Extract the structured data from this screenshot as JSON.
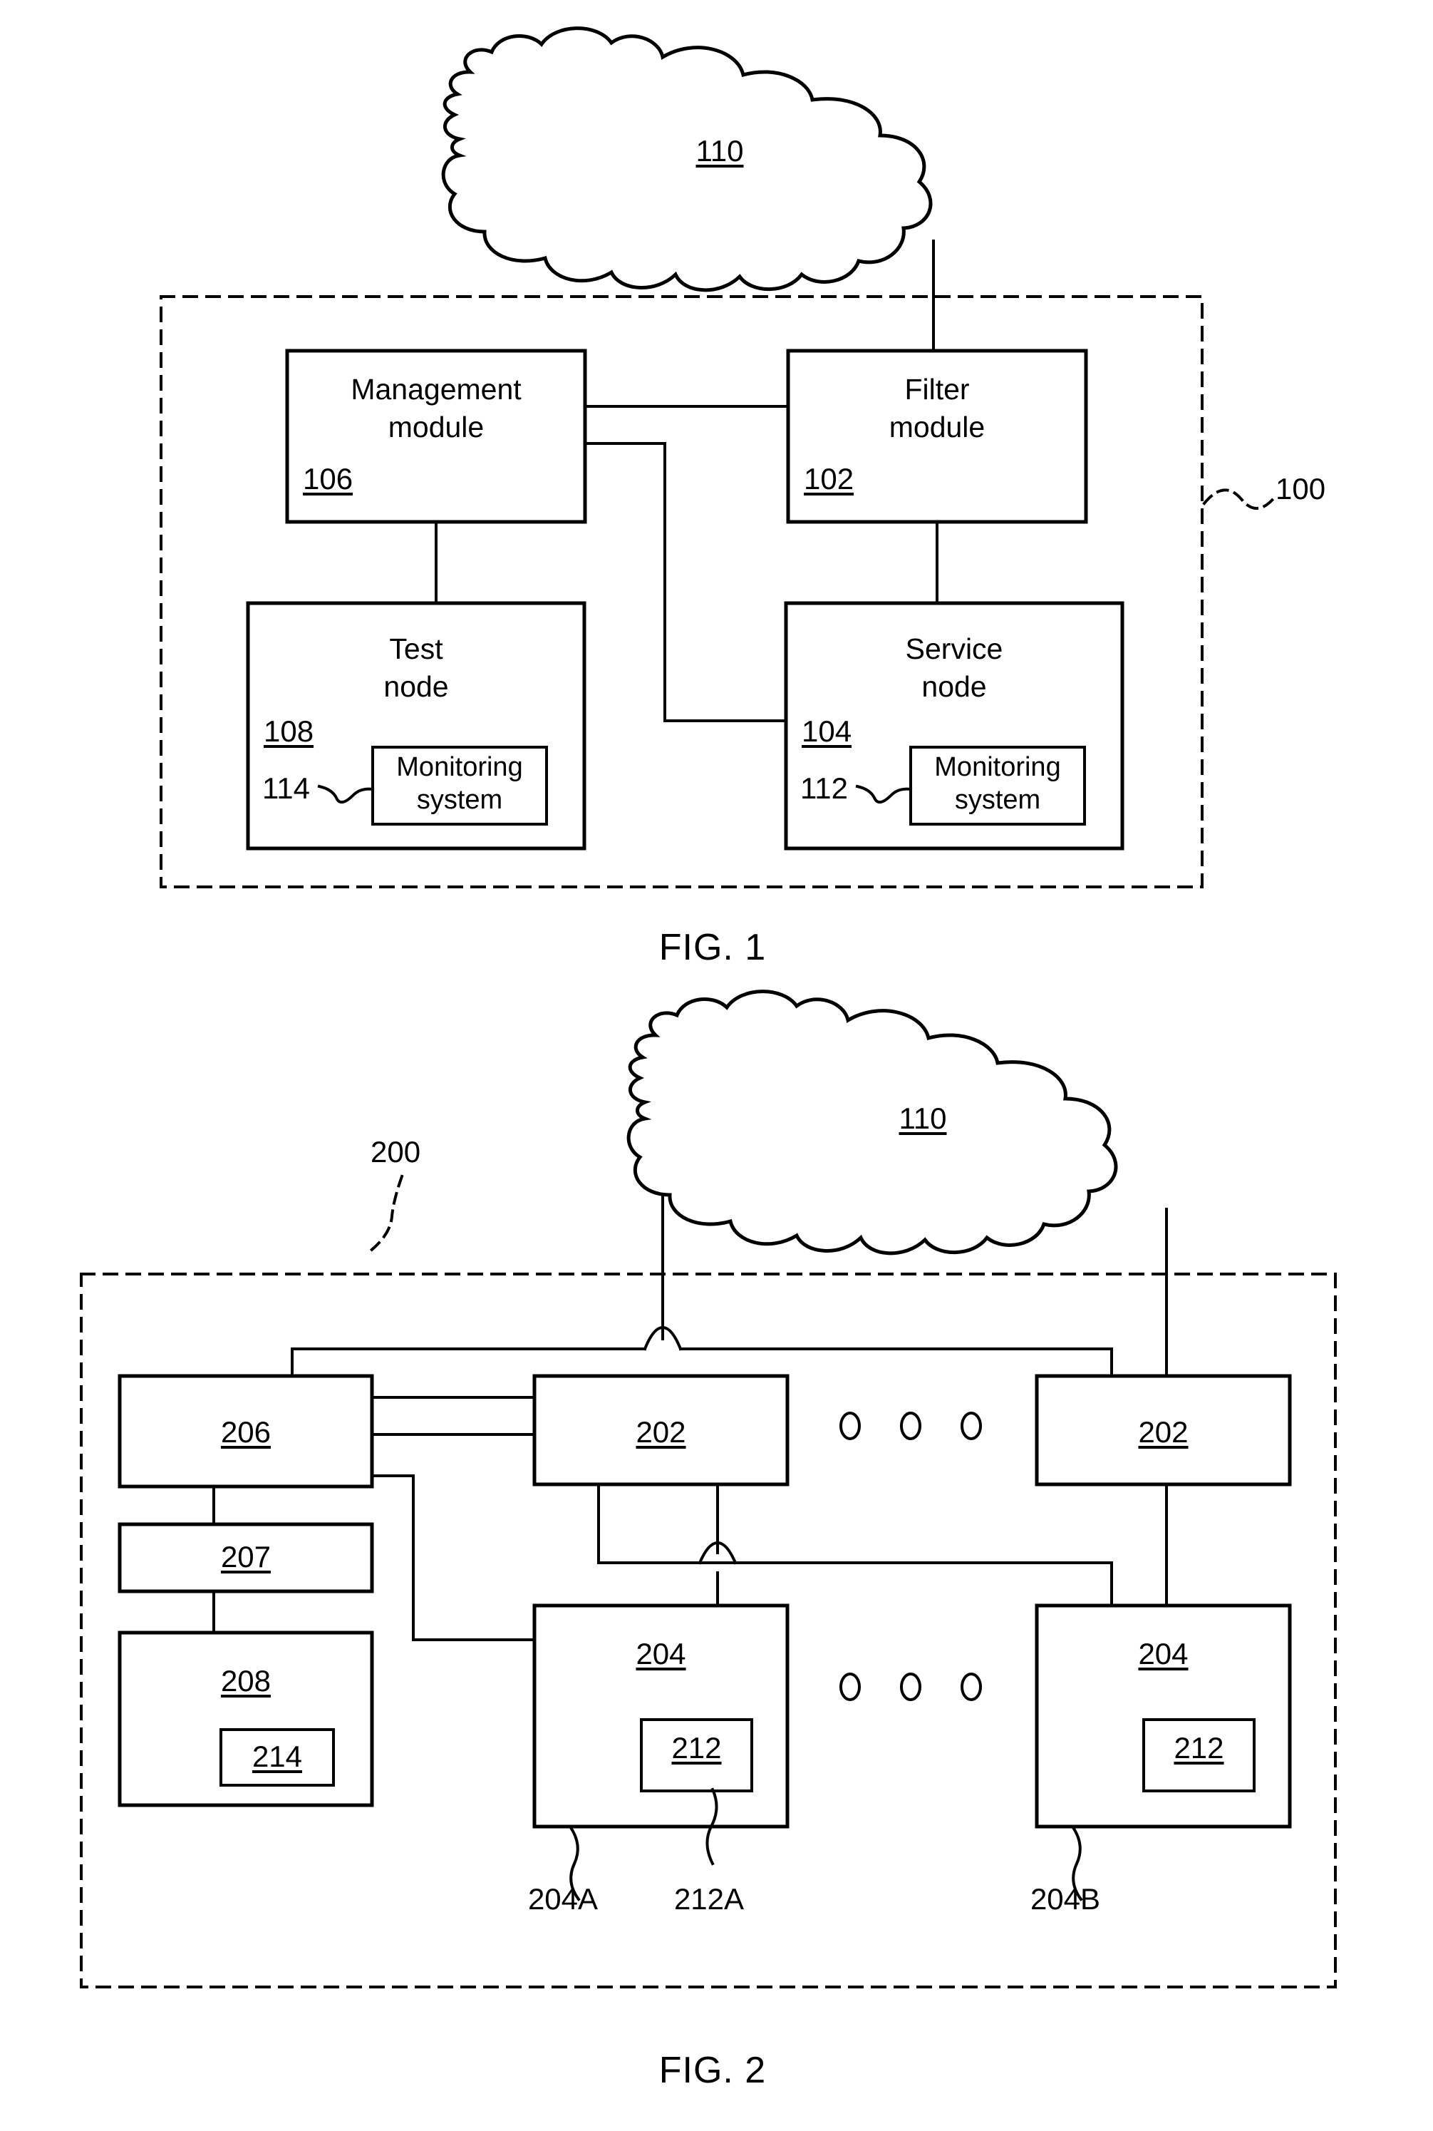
{
  "figures": [
    {
      "id": "fig1",
      "caption": "FIG. 1",
      "system_ref": "100",
      "cloud": {
        "ref": "110"
      },
      "boxes": [
        {
          "key": "management_module",
          "title_line1": "Management",
          "title_line2": "module",
          "ref": "106"
        },
        {
          "key": "filter_module",
          "title_line1": "Filter",
          "title_line2": "module",
          "ref": "102"
        },
        {
          "key": "test_node",
          "title_line1": "Test",
          "title_line2": "node",
          "ref": "108",
          "inner": {
            "key": "monitoring_system_test",
            "line1": "Monitoring",
            "line2": "system",
            "ref": "114"
          }
        },
        {
          "key": "service_node",
          "title_line1": "Service",
          "title_line2": "node",
          "ref": "104",
          "inner": {
            "key": "monitoring_system_service",
            "line1": "Monitoring",
            "line2": "system",
            "ref": "112"
          }
        }
      ]
    },
    {
      "id": "fig2",
      "caption": "FIG. 2",
      "system_ref": "200",
      "cloud": {
        "ref": "110"
      },
      "boxes": [
        {
          "key": "box_206",
          "ref": "206"
        },
        {
          "key": "box_207",
          "ref": "207"
        },
        {
          "key": "box_208",
          "ref": "208",
          "inner": {
            "key": "box_214",
            "ref": "214"
          }
        },
        {
          "key": "box_202_left",
          "ref": "202"
        },
        {
          "key": "box_202_right",
          "ref": "202"
        },
        {
          "key": "box_204_left",
          "ref": "204",
          "inner": {
            "key": "box_212_left",
            "ref": "212"
          }
        },
        {
          "key": "box_204_right",
          "ref": "204",
          "inner": {
            "key": "box_212_right",
            "ref": "212"
          }
        }
      ],
      "leader_labels": [
        {
          "key": "label_204A",
          "text": "204A"
        },
        {
          "key": "label_212A",
          "text": "212A"
        },
        {
          "key": "label_204B",
          "text": "204B"
        }
      ],
      "ellipsis_rows": [
        {
          "key": "ellipsis_202_row",
          "count": 3
        },
        {
          "key": "ellipsis_204_row",
          "count": 3
        }
      ]
    }
  ],
  "colors": {
    "ink": "#000000",
    "paper": "#ffffff"
  }
}
